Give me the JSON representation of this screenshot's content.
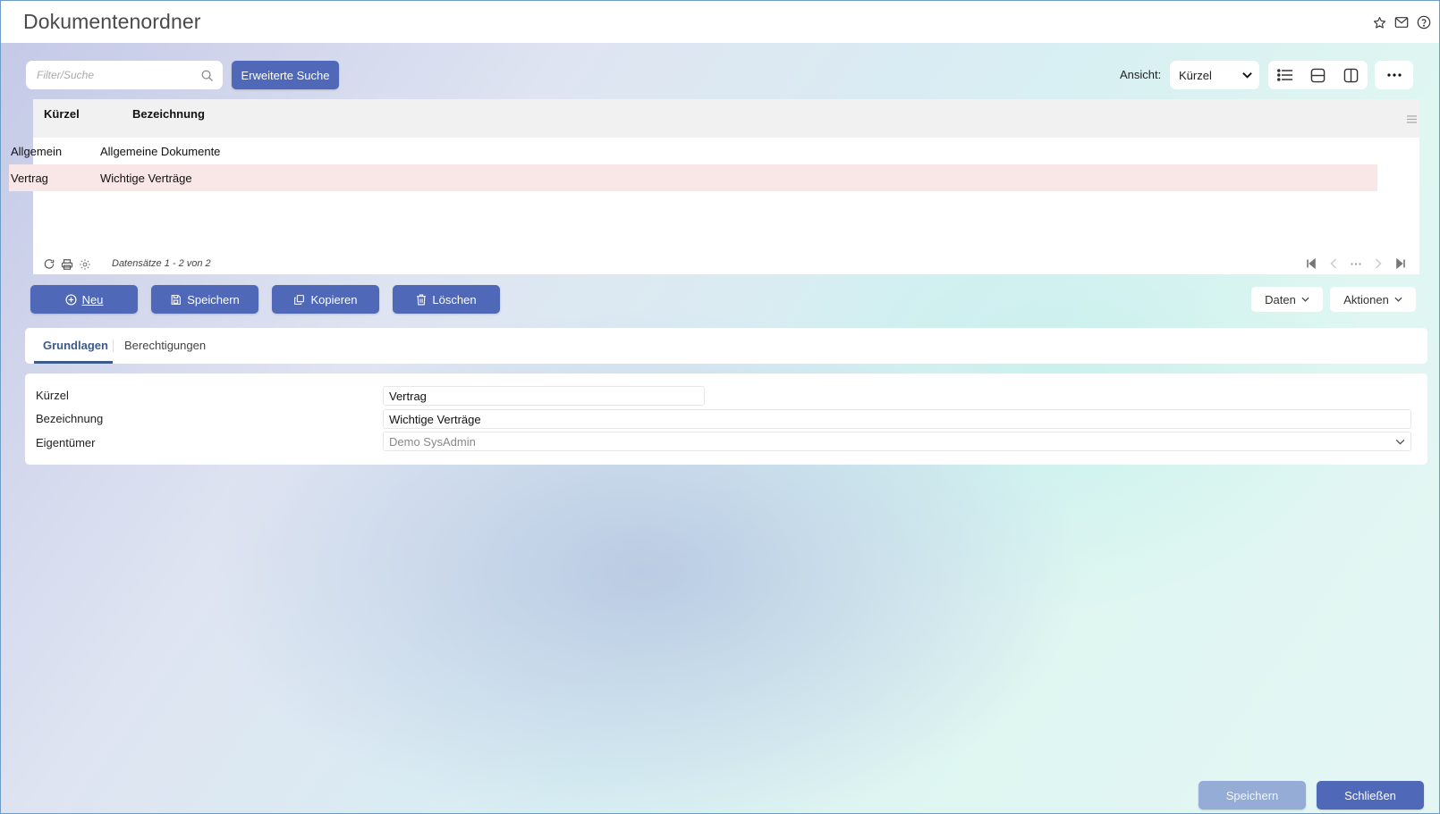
{
  "header": {
    "title": "Dokumentenordner",
    "icons": [
      "star-icon",
      "mail-icon",
      "help-icon"
    ]
  },
  "toolbar": {
    "search_placeholder": "Filter/Suche",
    "search_value": "",
    "advanced_search_label": "Erweiterte Suche",
    "view_label": "Ansicht:",
    "view_selected": "Kürzel"
  },
  "grid": {
    "columns": [
      "Kürzel",
      "Bezeichnung"
    ],
    "rows": [
      {
        "kuerzel": "Allgemein",
        "bezeichnung": "Allgemeine Dokumente",
        "selected": false
      },
      {
        "kuerzel": "Vertrag",
        "bezeichnung": "Wichtige Verträge",
        "selected": true
      }
    ],
    "record_info": "Datensätze 1 - 2 von 2"
  },
  "actions": {
    "new_label": "Neu",
    "save_label": "Speichern",
    "copy_label": "Kopieren",
    "delete_label": "Löschen",
    "data_label": "Daten",
    "actions_label": "Aktionen"
  },
  "tabs": [
    {
      "label": "Grundlagen",
      "active": true
    },
    {
      "label": "Berechtigungen",
      "active": false
    }
  ],
  "form": {
    "kuerzel_label": "Kürzel",
    "kuerzel_value": "Vertrag",
    "bezeichnung_label": "Bezeichnung",
    "bezeichnung_value": "Wichtige Verträge",
    "eigentuemer_label": "Eigentümer",
    "eigentuemer_value": "Demo SysAdmin"
  },
  "footer": {
    "save_label": "Speichern",
    "close_label": "Schließen"
  },
  "colors": {
    "primary": "#4f68b8",
    "primary_disabled": "#94acd6",
    "selected_row": "#f9e6e6",
    "tab_active": "#3d5a8a"
  }
}
